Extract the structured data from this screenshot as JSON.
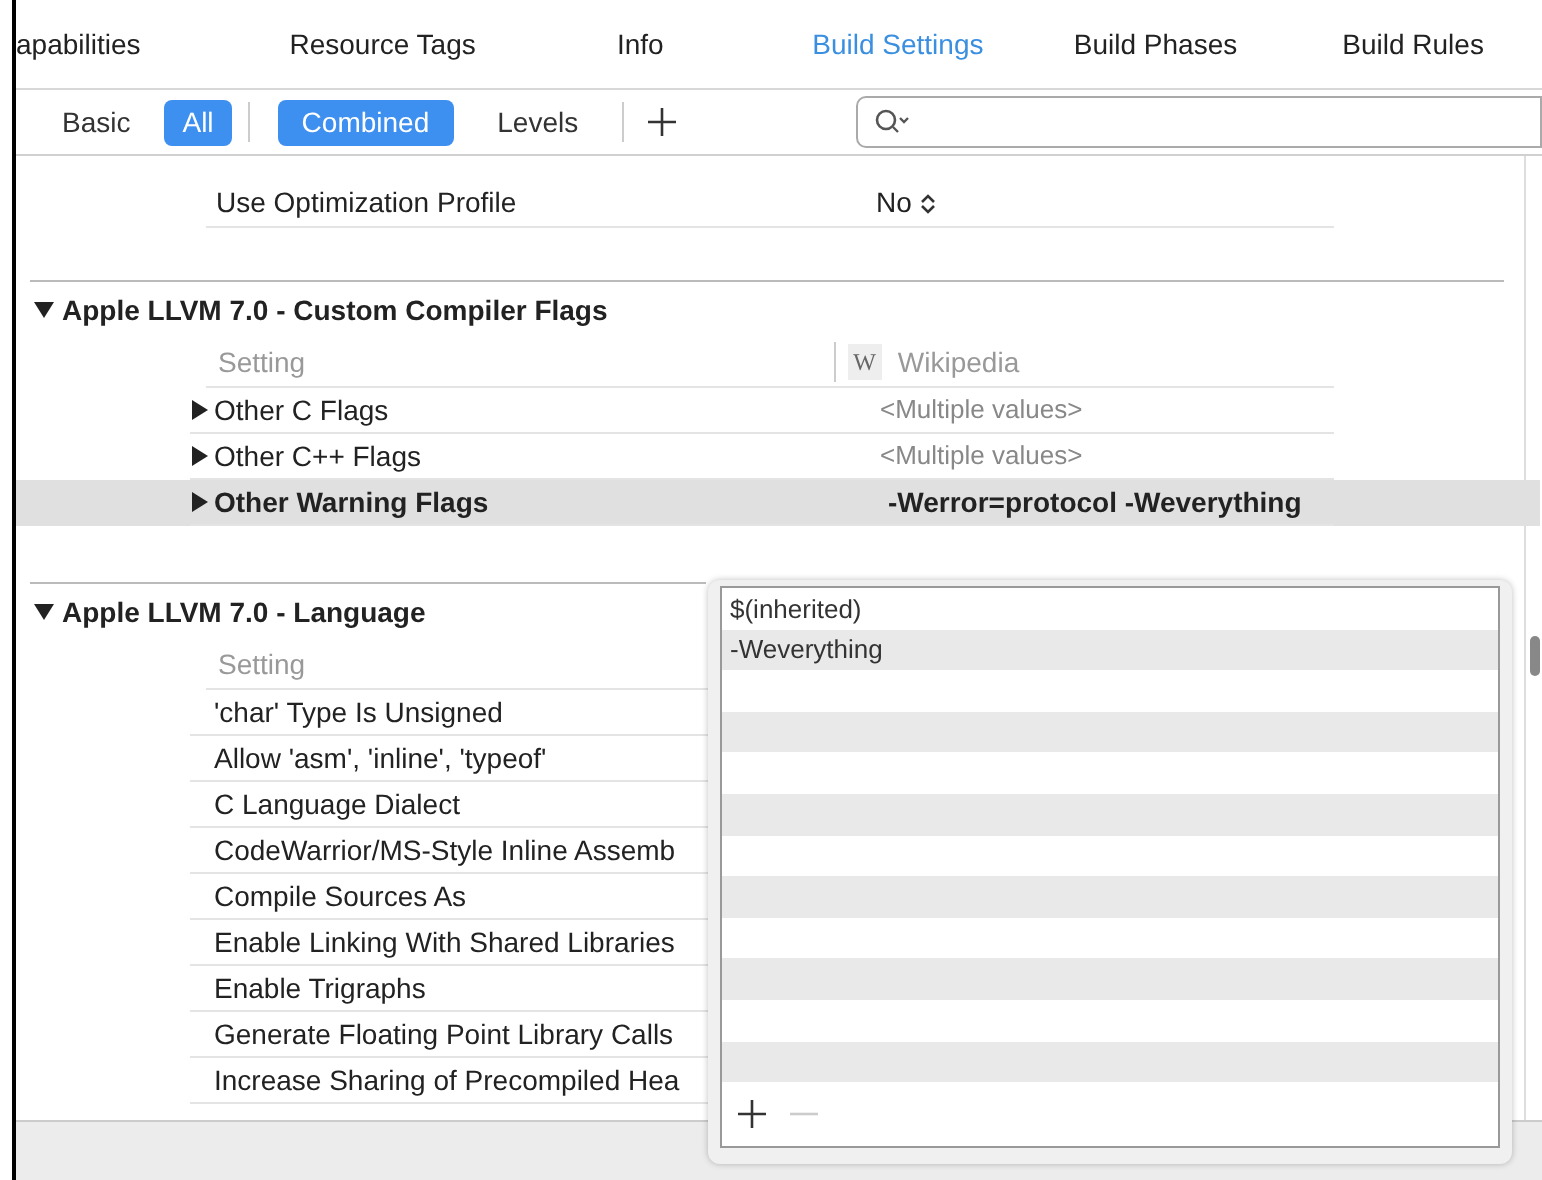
{
  "tabs": [
    {
      "label": "apabilities",
      "selected": false
    },
    {
      "label": "Resource Tags",
      "selected": false
    },
    {
      "label": "Info",
      "selected": false
    },
    {
      "label": "Build Settings",
      "selected": true
    },
    {
      "label": "Build Phases",
      "selected": false
    },
    {
      "label": "Build Rules",
      "selected": false
    }
  ],
  "scope_filters": [
    {
      "label": "Basic",
      "selected": false
    },
    {
      "label": "All",
      "selected": true
    }
  ],
  "view_filters": [
    {
      "label": "Combined",
      "selected": true
    },
    {
      "label": "Levels",
      "selected": false
    }
  ],
  "top_rows": [
    {
      "setting": "Use Optimization Profile",
      "value": "No"
    }
  ],
  "sections": [
    {
      "title": "Apple LLVM 7.0 - Custom Compiler Flags",
      "expanded": true,
      "setting_header": "Setting",
      "column_badge": "W",
      "column_header": "Wikipedia",
      "rows": [
        {
          "setting": "Other C Flags",
          "value": "<Multiple values>",
          "expandable": true,
          "selected": false
        },
        {
          "setting": "Other C++ Flags",
          "value": "<Multiple values>",
          "expandable": true,
          "selected": false
        },
        {
          "setting": "Other Warning Flags",
          "value": "-Werror=protocol -Weverything",
          "expandable": true,
          "selected": true
        }
      ]
    },
    {
      "title": "Apple LLVM 7.0 - Language",
      "expanded": true,
      "setting_header": "Setting",
      "rows": [
        {
          "setting": "'char' Type Is Unsigned",
          "expandable": false,
          "selected": false
        },
        {
          "setting": "Allow 'asm', 'inline', 'typeof'",
          "expandable": false,
          "selected": false
        },
        {
          "setting": "C Language Dialect",
          "expandable": false,
          "selected": false
        },
        {
          "setting": "CodeWarrior/MS-Style Inline Assemb",
          "expandable": false,
          "selected": false
        },
        {
          "setting": "Compile Sources As",
          "expandable": false,
          "selected": false
        },
        {
          "setting": "Enable Linking With Shared Libraries",
          "expandable": false,
          "selected": false
        },
        {
          "setting": "Enable Trigraphs",
          "expandable": false,
          "selected": false
        },
        {
          "setting": "Generate Floating Point Library Calls",
          "expandable": false,
          "selected": false
        },
        {
          "setting": "Increase Sharing of Precompiled Hea",
          "expandable": false,
          "selected": false
        }
      ]
    }
  ],
  "value_editor": {
    "items": [
      "$(inherited)",
      "-Weverything"
    ],
    "remove_disabled": true
  }
}
